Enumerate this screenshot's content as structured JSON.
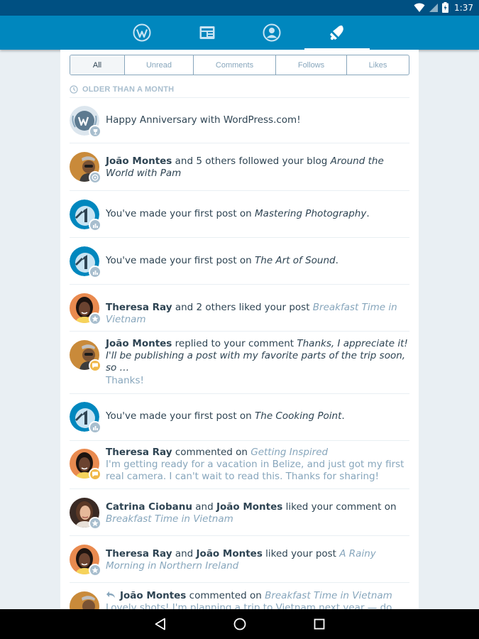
{
  "status_bar": {
    "time": "1:37"
  },
  "tabs": [
    {
      "icon": "wordpress-icon",
      "active": false
    },
    {
      "icon": "reader-icon",
      "active": false
    },
    {
      "icon": "profile-icon",
      "active": false
    },
    {
      "icon": "notifications-icon",
      "active": true
    }
  ],
  "filters": [
    {
      "label": "All",
      "active": true
    },
    {
      "label": "Unread",
      "active": false
    },
    {
      "label": "Comments",
      "active": false
    },
    {
      "label": "Follows",
      "active": false
    },
    {
      "label": "Likes",
      "active": false
    }
  ],
  "section": {
    "label": "OLDER THAN A MONTH",
    "icon": "clock-icon"
  },
  "notes": [
    {
      "id": "anniversary",
      "text": "Happy Anniversary with WordPress.com!",
      "badge_icon": "trophy-icon"
    },
    {
      "id": "follow",
      "name": "João Montes",
      "text": " and 5 others followed your blog ",
      "title": "Around the World with Pam",
      "badge_icon": "follow-icon"
    },
    {
      "id": "firstpost1",
      "text": "You've made your first post on ",
      "title": "Mastering Photography",
      "end": ".",
      "badge_icon": "stats-icon"
    },
    {
      "id": "firstpost2",
      "text": "You've made your first post on ",
      "title": "The Art of Sound",
      "end": ".",
      "badge_icon": "stats-icon"
    },
    {
      "id": "like1",
      "name": "Theresa Ray",
      "text": " and 2 others liked your post ",
      "title": "Breakfast Time in Vietnam",
      "badge_icon": "star-icon"
    },
    {
      "id": "reply1",
      "name": "João Montes",
      "text": " replied to your comment ",
      "title": "Thanks, I appreciate it! I'll be publishing a post with my favorite parts of the trip soon, so …",
      "excerpt": "Thanks!",
      "badge_icon": "comment-icon"
    },
    {
      "id": "firstpost3",
      "text": "You've made your first post on ",
      "title": "The Cooking Point",
      "end": ".",
      "badge_icon": "stats-icon"
    },
    {
      "id": "comment1",
      "name": "Theresa Ray",
      "text": " commented on ",
      "title": "Getting Inspired",
      "excerpt": "I'm getting ready for a vacation in Belize, and just got my first real camera. I can't wait to read this. Thanks for sharing!",
      "badge_icon": "comment-icon"
    },
    {
      "id": "like2",
      "name": "Catrina Ciobanu",
      "text": " and ",
      "name2": "João Montes",
      "text2": " liked your comment on ",
      "title": "Breakfast Time in Vietnam",
      "badge_icon": "star-icon"
    },
    {
      "id": "like3",
      "name": "Theresa Ray",
      "text": " and ",
      "name2": "João Montes",
      "text2": " liked your post ",
      "title": "A Rainy Morning in Northern Ireland",
      "badge_icon": "star-icon"
    },
    {
      "id": "comment2",
      "name": "João Montes",
      "text": " commented on ",
      "title": "Breakfast Time in Vietnam",
      "excerpt": "Lovely shots! I'm planning a trip to Vietnam next year — do you have",
      "badge_icon": "comment-icon"
    }
  ],
  "nav": [
    {
      "icon": "back-icon"
    },
    {
      "icon": "home-icon"
    },
    {
      "icon": "recents-icon"
    }
  ],
  "colors": {
    "status_bar": "#005082",
    "app_bar": "#0087be",
    "background": "#e9eff3",
    "link": "#87a6bc",
    "text": "#2e4453",
    "badge_orange": "#f0b849",
    "badge_grey": "#a8bece"
  }
}
